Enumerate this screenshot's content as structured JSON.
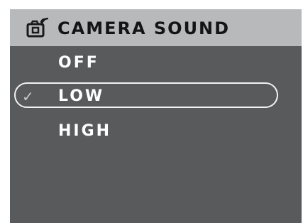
{
  "header": {
    "title": "CAMERA SOUND",
    "icon": "camera-sound-icon"
  },
  "menu": {
    "items": [
      {
        "label": "OFF",
        "selected": false
      },
      {
        "label": "LOW",
        "selected": true
      },
      {
        "label": "HIGH",
        "selected": false
      }
    ],
    "check_mark": "✓"
  },
  "colors": {
    "header_background": "#b8b9ba",
    "screen_background": "#595a5b",
    "header_text": "#141414",
    "item_text": "#ffffff",
    "selection_outline": "#f2f2f2",
    "check_mark": "#c9c9c9"
  }
}
